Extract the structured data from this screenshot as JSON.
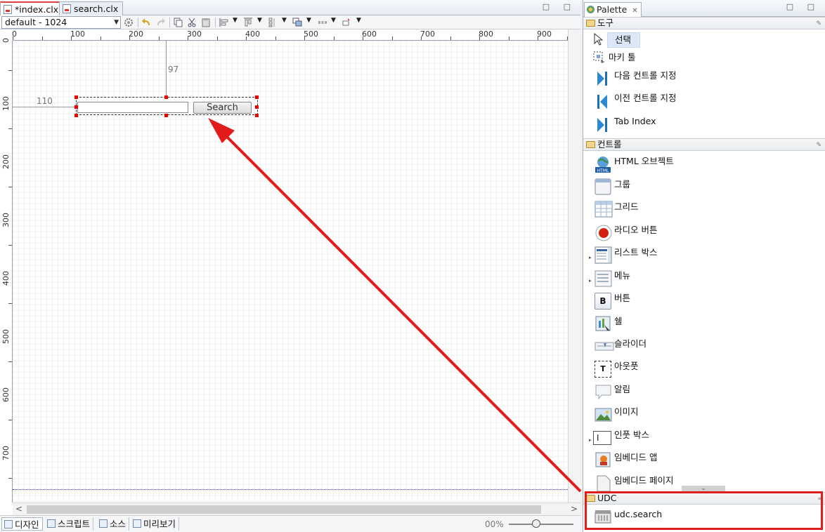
{
  "editor": {
    "tabs": [
      {
        "label": "*index.clx",
        "active": true
      },
      {
        "label": "search.clx",
        "active": false
      }
    ],
    "window_buttons": "□ □",
    "layout_select": "default - 1024",
    "ruler_h": [
      "0",
      "100",
      "200",
      "300",
      "400",
      "500",
      "600",
      "700",
      "800",
      "900"
    ],
    "ruler_v": [
      "0",
      "100",
      "200",
      "300",
      "400",
      "500",
      "600",
      "700"
    ],
    "guide_vertical_value": "97",
    "guide_horizontal_value": "110",
    "udc_button_label": "Search",
    "bottom_tabs": [
      "디자인",
      "스크립트",
      "소스",
      "미리보기"
    ],
    "zoom_value": "00%",
    "scroll_left": "<",
    "scroll_right": ">"
  },
  "palette": {
    "title": "Palette",
    "window_buttons": "□ □",
    "drawers": {
      "tools": {
        "label": "도구",
        "items": [
          "선택",
          "마키 툴",
          "다음 컨트롤 지정",
          "이전 컨트롤 지정",
          "Tab Index"
        ]
      },
      "controls": {
        "label": "컨트롤",
        "items": [
          "HTML 오브젝트",
          "그룹",
          "그리드",
          "라디오 버튼",
          "리스트 박스",
          "메뉴",
          "버튼",
          "쉘",
          "슬라이더",
          "아웃풋",
          "알림",
          "이미지",
          "인풋 박스",
          "임베디드 앱",
          "임베디드 페이지"
        ]
      },
      "udc": {
        "label": "UDC",
        "items": [
          "udc.search"
        ]
      }
    }
  },
  "colors": {
    "highlight_red": "#e21b1b",
    "selection_blue": "#dce8f7"
  }
}
